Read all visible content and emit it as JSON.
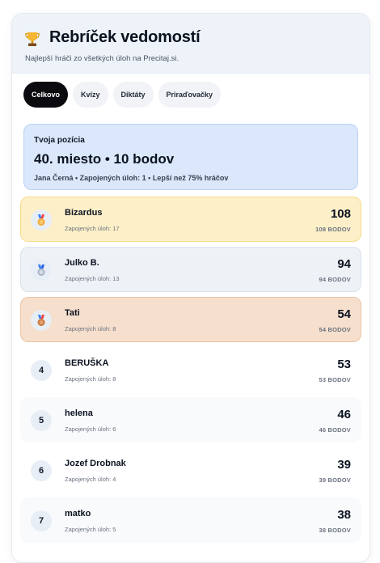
{
  "header": {
    "title": "Rebríček vedomostí",
    "subtitle": "Najlepší hráči zo všetkých úloh na Precitaj.si."
  },
  "tabs": [
    {
      "label": "Celkovo",
      "active": true
    },
    {
      "label": "Kvízy",
      "active": false
    },
    {
      "label": "Diktáty",
      "active": false
    },
    {
      "label": "Priraďovačky",
      "active": false
    }
  ],
  "position": {
    "label": "Tvoja pozícia",
    "main": "40. miesto • 10 bodov",
    "meta": "Jana Černá • Zapojených úloh: 1 • Lepší než 75% hráčov"
  },
  "colors": {
    "gold": "#fdf0c8",
    "silver": "#eef2f7",
    "bronze": "#f6dfcc",
    "accent": "#0b0b0f"
  },
  "leaderboard": [
    {
      "rank": "",
      "medal": "gold-medal-icon",
      "name": "Bizardus",
      "tasks": "Zapojených úloh: 17",
      "points": "108",
      "points_label": "108 BODOV"
    },
    {
      "rank": "",
      "medal": "silver-medal-icon",
      "name": "Julko B.",
      "tasks": "Zapojených úloh: 13",
      "points": "94",
      "points_label": "94 BODOV"
    },
    {
      "rank": "",
      "medal": "bronze-medal-icon",
      "name": "Tati",
      "tasks": "Zapojených úloh: 8",
      "points": "54",
      "points_label": "54 BODOV"
    },
    {
      "rank": "4",
      "medal": "",
      "name": "BERUŠKA",
      "tasks": "Zapojených úloh: 8",
      "points": "53",
      "points_label": "53 BODOV"
    },
    {
      "rank": "5",
      "medal": "",
      "name": "helena",
      "tasks": "Zapojených úloh: 6",
      "points": "46",
      "points_label": "46 BODOV"
    },
    {
      "rank": "6",
      "medal": "",
      "name": "Jozef Drobnak",
      "tasks": "Zapojených úloh: 4",
      "points": "39",
      "points_label": "39 BODOV"
    },
    {
      "rank": "7",
      "medal": "",
      "name": "matko",
      "tasks": "Zapojených úloh: 5",
      "points": "38",
      "points_label": "38 BODOV"
    }
  ]
}
